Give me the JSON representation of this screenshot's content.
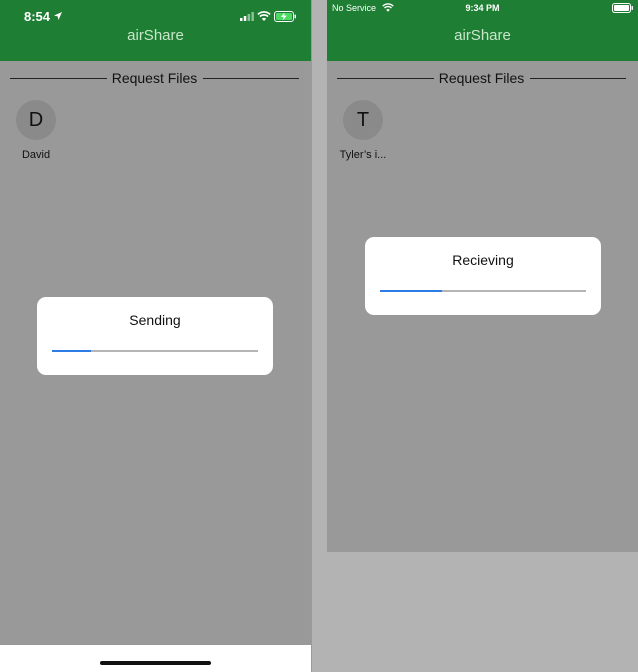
{
  "app": {
    "title": "airShare"
  },
  "left_screen": {
    "status_bar": {
      "time": "8:54"
    },
    "section_title": "Request Files",
    "peer": {
      "initial": "D",
      "name": "David"
    },
    "dialog": {
      "title": "Sending",
      "progress": 0.19
    }
  },
  "right_screen": {
    "status_bar": {
      "carrier": "No Service",
      "time": "9:34 PM"
    },
    "section_title": "Request Files",
    "peer": {
      "initial": "T",
      "name": "Tyler’s i..."
    },
    "dialog": {
      "title": "Recieving",
      "progress": 0.3
    }
  },
  "colors": {
    "header": "#1e7e34",
    "app_title": "#c8e6c9",
    "overlay": "#999999",
    "progress": "#2d7be5"
  },
  "icons": [
    "location-arrow-icon",
    "signal-icon",
    "wifi-icon",
    "battery-charging-icon",
    "battery-icon"
  ]
}
